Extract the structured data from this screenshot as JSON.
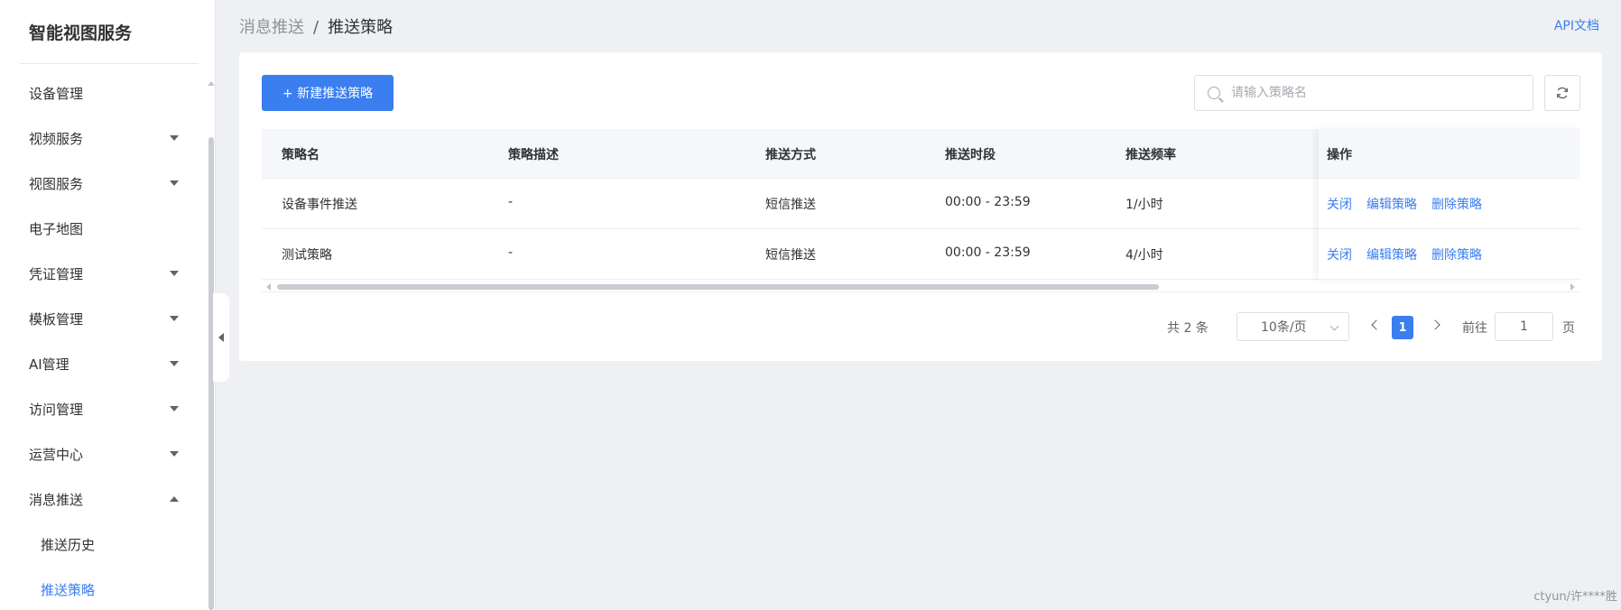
{
  "sidebar": {
    "title": "智能视图服务",
    "items": [
      {
        "label": "设备管理",
        "expandable": false
      },
      {
        "label": "视频服务",
        "expandable": true
      },
      {
        "label": "视图服务",
        "expandable": true
      },
      {
        "label": "电子地图",
        "expandable": false
      },
      {
        "label": "凭证管理",
        "expandable": true
      },
      {
        "label": "模板管理",
        "expandable": true
      },
      {
        "label": "AI管理",
        "expandable": true
      },
      {
        "label": "访问管理",
        "expandable": true
      },
      {
        "label": "运营中心",
        "expandable": true
      },
      {
        "label": "消息推送",
        "expandable": true,
        "expanded": true
      }
    ],
    "subitems": [
      {
        "label": "推送历史",
        "active": false
      },
      {
        "label": "推送策略",
        "active": true
      }
    ]
  },
  "header": {
    "breadcrumb_parent": "消息推送",
    "breadcrumb_sep": "/",
    "breadcrumb_current": "推送策略",
    "api_link": "API文档"
  },
  "toolbar": {
    "new_button": "+ 新建推送策略",
    "search_placeholder": "请输入策略名"
  },
  "table": {
    "columns": [
      "策略名",
      "策略描述",
      "推送方式",
      "推送时段",
      "推送频率",
      "操作"
    ],
    "rows": [
      {
        "name": "设备事件推送",
        "desc": "-",
        "method": "短信推送",
        "period": "00:00 - 23:59",
        "freq": "1/小时"
      },
      {
        "name": "测试策略",
        "desc": "-",
        "method": "短信推送",
        "period": "00:00 - 23:59",
        "freq": "4/小时"
      }
    ],
    "ops": [
      "关闭",
      "编辑策略",
      "删除策略"
    ]
  },
  "pagination": {
    "total": "共 2 条",
    "page_size": "10条/页",
    "current_page": "1",
    "goto_label": "前往",
    "goto_value": "1",
    "goto_unit": "页"
  },
  "watermark": "ctyun/许****胜",
  "colors": {
    "accent": "#3a7ef0",
    "background": "#eef0f3"
  }
}
